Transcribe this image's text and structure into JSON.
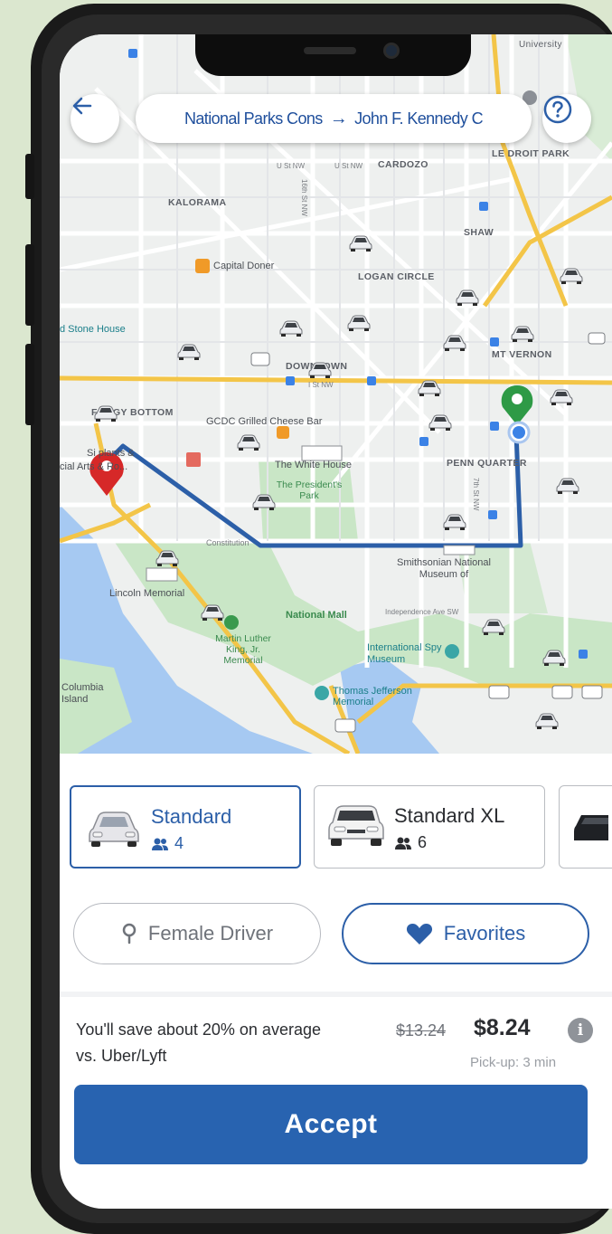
{
  "route": {
    "origin": "National Parks Cons",
    "arrow": "→",
    "destination": "John F. Kennedy C"
  },
  "icons": {
    "back": "arrow-left-icon",
    "help": "question-circle-icon",
    "seats": "people-icon",
    "female_driver": "map-pin-icon",
    "favorites": "heart-icon",
    "info": "info-icon"
  },
  "map": {
    "labels": {
      "cardozo": "CARDOZO",
      "le_droit_park": "LE DROIT PARK",
      "kalorama": "KALORAMA",
      "shaw": "SHAW",
      "logan_circle": "LOGAN CIRCLE",
      "downtown": "DOWNTOWN",
      "mt_vernon": "MT VERNON",
      "foggy_bottom": "FOGGY BOTTOM",
      "penn_quarter": "PENN QUARTER",
      "university": "University",
      "stone_house": "d Stone House",
      "capital_doner": "Capital Doner",
      "gcdc": "GCDC Grilled Cheese Bar",
      "white_house": "The White House",
      "presidents_park": "The President's Park",
      "smithsonian": "Smithsonian National Museum of",
      "lincoln_memorial": "Lincoln Memorial",
      "national_mall": "National Mall",
      "mlk_memorial": "Martin Luther King, Jr. Memorial",
      "spy_museum": "International Spy Museum",
      "jefferson_memorial": "Thomas Jefferson Memorial",
      "columbia_island": "Columbia Island",
      "constitution": "Constitution",
      "independence": "Independence Ave SW",
      "u_st_1": "U St NW",
      "u_st_2": "U St NW",
      "i_st": "I St NW",
      "sixteenth": "16th St NW",
      "seventh": "7th St NW",
      "arts": "cial Arts & Ro...",
      "sinal": "Si  plants &"
    },
    "colors": {
      "route_line": "#2c5fa8",
      "origin_pin": "#2e9a46",
      "destination_pin": "#d62828",
      "water": "#a6c9f2",
      "park": "#c9e6c6",
      "highway": "#f3c548"
    }
  },
  "vehicles": [
    {
      "name": "Standard",
      "seats": "4",
      "selected": true
    },
    {
      "name": "Standard XL",
      "seats": "6",
      "selected": false
    }
  ],
  "options": {
    "female_driver": "Female Driver",
    "favorites": "Favorites"
  },
  "fare": {
    "savings_text": "You'll save about 20% on average vs. Uber/Lyft",
    "old_price": "$13.24",
    "new_price": "$8.24",
    "info_glyph": "i",
    "pickup": "Pick-up: 3 min"
  },
  "accept_label": "Accept"
}
